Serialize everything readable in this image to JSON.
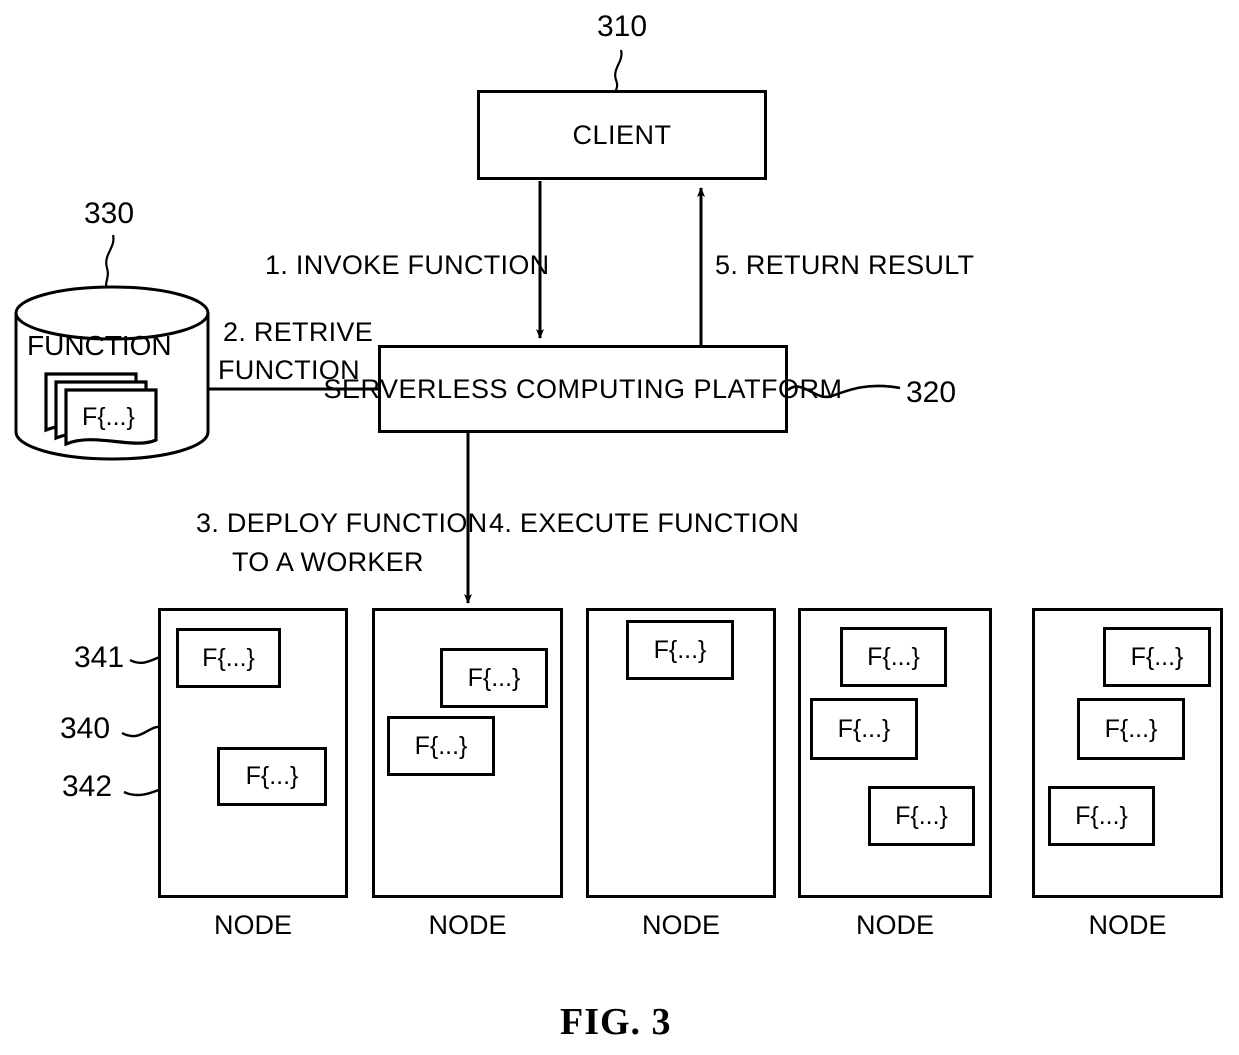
{
  "figure": {
    "caption": "FIG. 3",
    "client": {
      "label": "CLIENT",
      "ref": "310"
    },
    "platform": {
      "label": "SERVERLESS COMPUTING PLATFORM",
      "ref": "320"
    },
    "store": {
      "label": "FUNCTION",
      "ref": "330",
      "card_label": "F{...}"
    },
    "flows": [
      {
        "id": "flow-1",
        "label": "1. INVOKE FUNCTION"
      },
      {
        "id": "flow-2",
        "label_line1": "2. RETRIVE",
        "label_line2": "FUNCTION"
      },
      {
        "id": "flow-3",
        "label_line1": "3. DEPLOY FUNCTION",
        "label_line2": "TO A WORKER"
      },
      {
        "id": "flow-4",
        "label": "4. EXECUTE FUNCTION"
      },
      {
        "id": "flow-5",
        "label": "5. RETURN RESULT"
      }
    ],
    "node_group_ref": "340",
    "function_refs": {
      "first": "341",
      "second": "342"
    },
    "nodes": [
      {
        "label": "NODE",
        "functions": [
          {
            "label": "F{...}"
          },
          {
            "label": "F{...}"
          }
        ]
      },
      {
        "label": "NODE",
        "functions": [
          {
            "label": "F{...}"
          },
          {
            "label": "F{...}"
          }
        ]
      },
      {
        "label": "NODE",
        "functions": [
          {
            "label": "F{...}"
          }
        ]
      },
      {
        "label": "NODE",
        "functions": [
          {
            "label": "F{...}"
          },
          {
            "label": "F{...}"
          },
          {
            "label": "F{...}"
          }
        ]
      },
      {
        "label": "NODE",
        "functions": [
          {
            "label": "F{...}"
          },
          {
            "label": "F{...}"
          },
          {
            "label": "F{...}"
          }
        ]
      }
    ]
  }
}
